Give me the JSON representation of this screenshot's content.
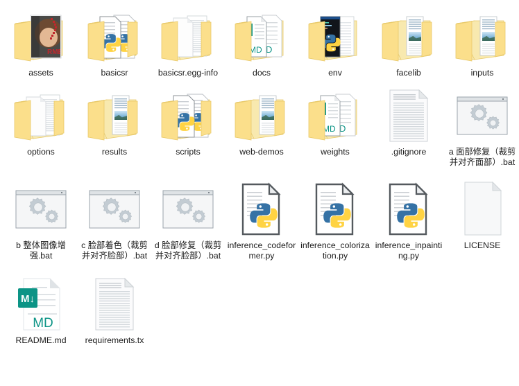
{
  "window": {
    "kind": "file-explorer-icon-view",
    "background": "#ffffff",
    "text_color": "#1b1b1b",
    "columns": 7
  },
  "palette": {
    "folder_front": "#fbdf8b",
    "folder_back": "#f8e9af",
    "folder_edge": "#e8c96a",
    "paper_white": "#ffffff",
    "paper_line": "#c9cdd2",
    "paper_border": "#d3d7db",
    "python_blue": "#3572a5",
    "python_yellow": "#ffd343",
    "md_teal": "#0c9486",
    "bat_gear": "#c3ccd3",
    "bat_frame": "#9aa3ab",
    "accent_red": "#c0272d"
  },
  "items": [
    {
      "name": "assets",
      "label": "assets",
      "type": "folder",
      "variant": "photo-preview",
      "row": 0,
      "col": 0
    },
    {
      "name": "basicsr",
      "label": "basicsr",
      "type": "folder",
      "variant": "python-preview",
      "row": 0,
      "col": 1
    },
    {
      "name": "basicsr.egg-info",
      "label": "basicsr.egg-info",
      "type": "folder",
      "variant": "plain-doc-preview",
      "row": 0,
      "col": 2
    },
    {
      "name": "docs",
      "label": "docs",
      "type": "folder",
      "variant": "md-preview",
      "row": 0,
      "col": 3
    },
    {
      "name": "env",
      "label": "env",
      "type": "folder",
      "variant": "python-dark-preview",
      "row": 0,
      "col": 4
    },
    {
      "name": "facelib",
      "label": "facelib",
      "type": "folder",
      "variant": "image-preview",
      "row": 0,
      "col": 5
    },
    {
      "name": "inputs",
      "label": "inputs",
      "type": "folder",
      "variant": "image-preview",
      "row": 0,
      "col": 6
    },
    {
      "name": "options",
      "label": "options",
      "type": "folder",
      "variant": "plain-doc-preview",
      "row": 1,
      "col": 0
    },
    {
      "name": "results",
      "label": "results",
      "type": "folder",
      "variant": "image-preview",
      "row": 1,
      "col": 1
    },
    {
      "name": "scripts",
      "label": "scripts",
      "type": "folder",
      "variant": "python-preview",
      "row": 1,
      "col": 2
    },
    {
      "name": "web-demos",
      "label": "web-demos",
      "type": "folder",
      "variant": "image-preview",
      "row": 1,
      "col": 3
    },
    {
      "name": "weights",
      "label": "weights",
      "type": "folder",
      "variant": "md-preview",
      "row": 1,
      "col": 4
    },
    {
      "name": ".gitignore",
      "label": ".gitignore",
      "type": "file",
      "variant": "text-doc",
      "row": 1,
      "col": 5
    },
    {
      "name": "a 面部修复（裁剪并对齐面部）.bat",
      "label": "a 面部修复（裁剪并对齐面部）.bat",
      "type": "file",
      "variant": "bat",
      "row": 1,
      "col": 6
    },
    {
      "name": "b 整体图像增强.bat",
      "label": "b 整体图像增强.bat",
      "type": "file",
      "variant": "bat",
      "row": 2,
      "col": 0
    },
    {
      "name": "c 脸部着色（裁剪并对齐脸部）.bat",
      "label": "c 脸部着色（裁剪并对齐脸部）.bat",
      "type": "file",
      "variant": "bat",
      "row": 2,
      "col": 1
    },
    {
      "name": "d 脸部修复（裁剪并对齐脸部）.bat",
      "label": "d 脸部修复（裁剪并对齐脸部）.bat",
      "type": "file",
      "variant": "bat",
      "row": 2,
      "col": 2
    },
    {
      "name": "inference_codeformer.py",
      "label": "inference_codeformer.py",
      "type": "file",
      "variant": "python",
      "row": 2,
      "col": 3
    },
    {
      "name": "inference_colorization.py",
      "label": "inference_colorization.py",
      "type": "file",
      "variant": "python",
      "row": 2,
      "col": 4
    },
    {
      "name": "inference_inpainting.py",
      "label": "inference_inpainting.py",
      "type": "file",
      "variant": "python",
      "row": 2,
      "col": 5
    },
    {
      "name": "LICENSE",
      "label": "LICENSE",
      "type": "file",
      "variant": "blank-doc",
      "row": 2,
      "col": 6
    },
    {
      "name": "README.md",
      "label": "README.md",
      "type": "file",
      "variant": "markdown",
      "row": 3,
      "col": 0
    },
    {
      "name": "requirements.txt",
      "label": "requirements.tx",
      "type": "file",
      "variant": "text-doc",
      "row": 3,
      "col": 1
    }
  ]
}
